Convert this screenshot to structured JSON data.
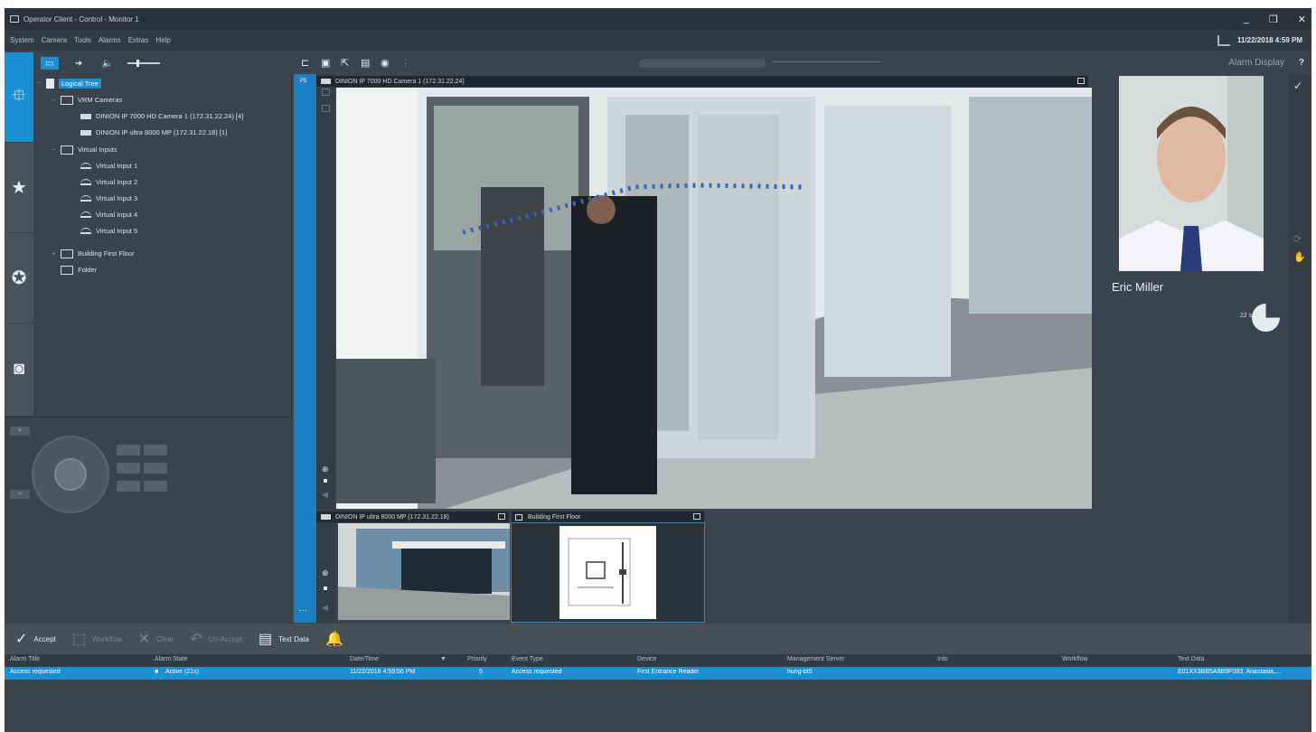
{
  "window": {
    "title": "Operator Client - Control - Monitor 1",
    "controls": {
      "minimize": "_",
      "restore": "❐",
      "close": "✕"
    }
  },
  "menu": [
    "System",
    "Camera",
    "Tools",
    "Alarms",
    "Extras",
    "Help"
  ],
  "clock": "11/22/2018 4:59 PM",
  "nav": {
    "items": [
      {
        "icon": "logical-tree-icon",
        "glyph": "⯐",
        "active": true
      },
      {
        "icon": "favorites-star-icon",
        "glyph": "★",
        "active": false
      },
      {
        "icon": "ptz-control-icon",
        "glyph": "✪",
        "active": false
      },
      {
        "icon": "monitor-icon",
        "glyph": "◙",
        "active": false
      }
    ]
  },
  "tree": {
    "root": "Logical Tree",
    "vrm_group": "VRM Cameras",
    "cameras": [
      "DINION IP 7000 HD Camera 1 (172.31.22.24) [4]",
      "DINION IP ultra 8000 MP (172.31.22.18) [1]"
    ],
    "virtual_group": "Virtual Inputs",
    "virtual_inputs": [
      "Virtual Input 1",
      "Virtual Input 2",
      "Virtual Input 3",
      "Virtual Input 4",
      "Virtual Input 5"
    ],
    "map_node": "Building First Floor",
    "folder": "Folder"
  },
  "main_toolbar": {
    "alarm_display_label": "Alarm Display",
    "help": "?"
  },
  "panes": {
    "large": {
      "title": "DINION IP 7000 HD Camera 1 (172.31.22.24)",
      "number": "P5"
    },
    "small_camera": {
      "title": "DINION IP ultra 8000 MP (172.31.22.18)"
    },
    "map": {
      "title": "Building First Floor"
    }
  },
  "alarm_display": {
    "person_name": "Eric Miller",
    "timer": "22 s",
    "timer_fraction_remaining": 0.75
  },
  "alarm_bar": {
    "accept": "Accept",
    "workflow": "Workflow",
    "clear": "Clear",
    "unaccept": "Un-Accept",
    "text_data": "Text Data"
  },
  "alarm_table": {
    "columns": [
      "Alarm Title",
      "Alarm State",
      "Date/Time",
      "Priority",
      "Event Type",
      "Device",
      "Management Server",
      "Info",
      "Workflow",
      "Text Data"
    ],
    "rows": [
      {
        "title": "Access requested",
        "state": "Active (21s)",
        "datetime": "11/22/2018 4:59:56 PM",
        "priority": "5",
        "event_type": "Access requested",
        "device": "First Entrance Reader",
        "server": "hung-bt5",
        "info": "",
        "workflow": "",
        "text_data": "E01XX3BB5A8B9F083, Anastasia,..."
      }
    ]
  },
  "colors": {
    "accent": "#1b8fd2",
    "background": "#3b444c",
    "titlebar": "#2b3238"
  }
}
